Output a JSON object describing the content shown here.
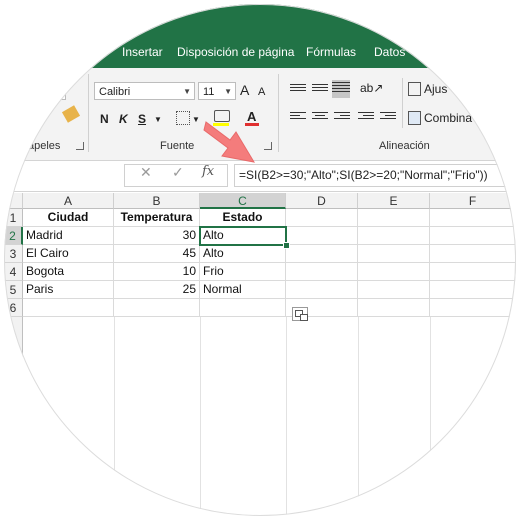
{
  "ribbon": {
    "tabs": [
      "Insertar",
      "Disposición de página",
      "Fórmulas",
      "Datos"
    ],
    "font_name": "Calibri",
    "font_size": "11",
    "bold": "N",
    "italic": "K",
    "underline": "S",
    "group_clipboard": "apeles",
    "group_font": "Fuente",
    "group_alignment": "Alineación",
    "wrap_label": "Ajus",
    "merge_label": "Combina"
  },
  "formula_bar": {
    "cancel": "✕",
    "confirm": "✓",
    "fx": "fx",
    "formula": "=SI(B2>=30;\"Alto\";SI(B2>=20;\"Normal\";\"Frio\"))"
  },
  "grid": {
    "columns": [
      "A",
      "B",
      "C",
      "D",
      "E",
      "F"
    ],
    "rows": [
      "1",
      "2",
      "3",
      "4",
      "5",
      "6"
    ],
    "headers": [
      "Ciudad",
      "Temperatura",
      "Estado"
    ],
    "data": [
      [
        "Madrid",
        "30",
        "Alto"
      ],
      [
        "El Cairo",
        "45",
        "Alto"
      ],
      [
        "Bogota",
        "10",
        "Frio"
      ],
      [
        "Paris",
        "25",
        "Normal"
      ]
    ]
  },
  "colors": {
    "excel_green": "#217346",
    "annotation_arrow": "#f47c7c"
  }
}
